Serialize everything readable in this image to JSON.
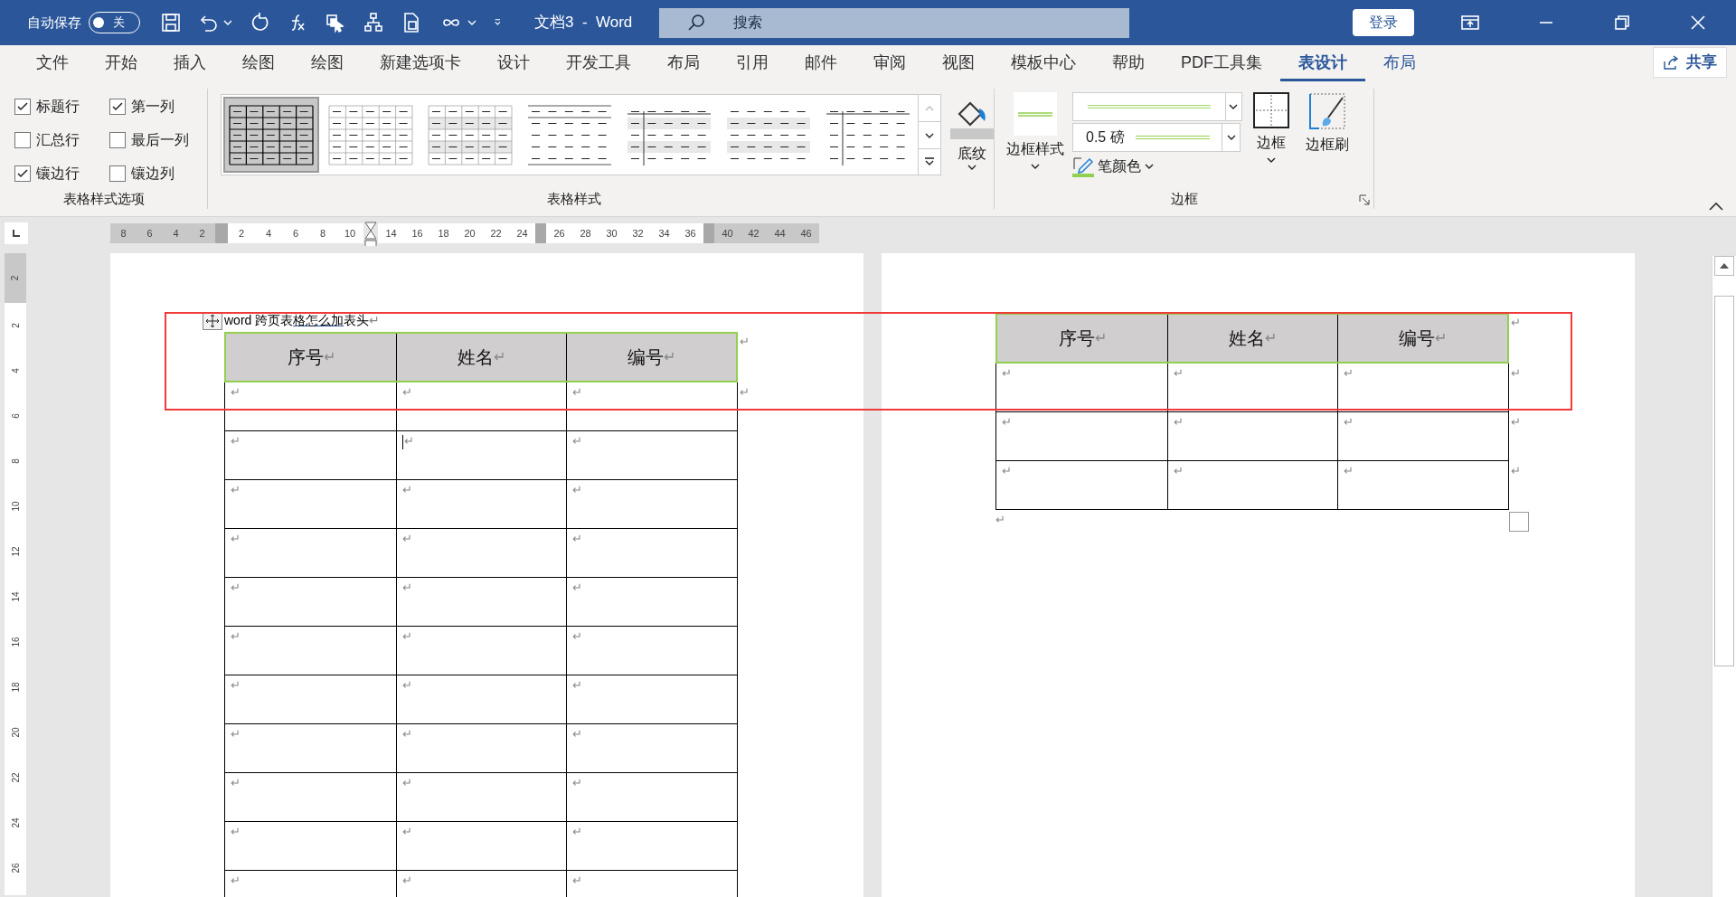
{
  "titlebar": {
    "autosave_label": "自动保存",
    "autosave_on": false,
    "autosave_state": "关",
    "title": "文档3  -  Word",
    "search": "搜索",
    "login": "登录"
  },
  "tabs": [
    {
      "label": "文件",
      "selected": false,
      "contextual": false
    },
    {
      "label": "开始",
      "selected": false,
      "contextual": false
    },
    {
      "label": "插入",
      "selected": false,
      "contextual": false
    },
    {
      "label": "绘图",
      "selected": false,
      "contextual": false
    },
    {
      "label": "绘图",
      "selected": false,
      "contextual": false
    },
    {
      "label": "新建选项卡",
      "selected": false,
      "contextual": false
    },
    {
      "label": "设计",
      "selected": false,
      "contextual": false
    },
    {
      "label": "开发工具",
      "selected": false,
      "contextual": false
    },
    {
      "label": "布局",
      "selected": false,
      "contextual": false
    },
    {
      "label": "引用",
      "selected": false,
      "contextual": false
    },
    {
      "label": "邮件",
      "selected": false,
      "contextual": false
    },
    {
      "label": "审阅",
      "selected": false,
      "contextual": false
    },
    {
      "label": "视图",
      "selected": false,
      "contextual": false
    },
    {
      "label": "模板中心",
      "selected": false,
      "contextual": false
    },
    {
      "label": "帮助",
      "selected": false,
      "contextual": false
    },
    {
      "label": "PDF工具集",
      "selected": false,
      "contextual": false
    },
    {
      "label": "表设计",
      "selected": true,
      "contextual": true
    },
    {
      "label": "布局",
      "selected": false,
      "contextual": true
    }
  ],
  "share": "共享",
  "ribbon": {
    "style_options": {
      "label": "表格样式选项",
      "options": [
        {
          "label": "标题行",
          "checked": true
        },
        {
          "label": "第一列",
          "checked": true
        },
        {
          "label": "汇总行",
          "checked": false
        },
        {
          "label": "最后一列",
          "checked": false
        },
        {
          "label": "镶边行",
          "checked": true
        },
        {
          "label": "镶边列",
          "checked": false
        }
      ]
    },
    "table_styles": {
      "label": "表格样式",
      "styles": [
        {
          "kind": "grid",
          "selected": true
        },
        {
          "kind": "light-grid",
          "selected": false
        },
        {
          "kind": "banded-grid",
          "selected": false
        },
        {
          "kind": "lines",
          "selected": false
        },
        {
          "kind": "first-col-banded",
          "selected": false
        },
        {
          "kind": "banded",
          "selected": false
        },
        {
          "kind": "first-col",
          "selected": false
        }
      ],
      "shading": "底纹"
    },
    "borders": {
      "label": "边框",
      "border_styles": "边框样式",
      "weight": "0.5 磅",
      "pen_color": "笔颜色",
      "borders": "边框",
      "painter": "边框刷"
    }
  },
  "ruler": {
    "left_gray": [
      "8",
      "6",
      "4",
      "2"
    ],
    "white_a": [
      "2",
      "4",
      "6",
      "8",
      "10"
    ],
    "white_b": [
      "14",
      "16",
      "18",
      "20",
      "22",
      "24"
    ],
    "white_c": [
      "26",
      "28",
      "30",
      "32",
      "34",
      "36"
    ],
    "right_gray": [
      "40",
      "42",
      "44",
      "46"
    ],
    "vertical": [
      "2",
      "2",
      "4",
      "6",
      "8",
      "10",
      "12",
      "14",
      "16",
      "18",
      "20",
      "22",
      "24",
      "26"
    ]
  },
  "left_page": {
    "heading": {
      "before": "word 跨页表",
      "underlined": "格怎么加",
      "after": "表头",
      "mark": "↵"
    },
    "table": {
      "header": [
        {
          "text": "序号",
          "mark": "↵"
        },
        {
          "text": "姓名",
          "mark": "↵"
        },
        {
          "text": "编号",
          "mark": "↵"
        }
      ],
      "header_end": "↵",
      "rows": [
        {
          "cells": [
            "↵",
            "↵",
            "↵"
          ],
          "end": "↵"
        },
        {
          "cells": [
            "↵",
            "↵",
            "↵"
          ],
          "cursor": true
        },
        {
          "cells": [
            "↵",
            "↵",
            "↵"
          ]
        },
        {
          "cells": [
            "↵",
            "↵",
            "↵"
          ]
        },
        {
          "cells": [
            "↵",
            "↵",
            "↵"
          ]
        },
        {
          "cells": [
            "↵",
            "↵",
            "↵"
          ]
        },
        {
          "cells": [
            "↵",
            "↵",
            "↵"
          ]
        },
        {
          "cells": [
            "↵",
            "↵",
            "↵"
          ]
        },
        {
          "cells": [
            "↵",
            "↵",
            "↵"
          ]
        },
        {
          "cells": [
            "↵",
            "↵",
            "↵"
          ]
        },
        {
          "cells": [
            "↵",
            "↵",
            "↵"
          ]
        }
      ]
    }
  },
  "right_page": {
    "table": {
      "header": [
        {
          "text": "序号",
          "mark": "↵"
        },
        {
          "text": "姓名",
          "mark": "↵"
        },
        {
          "text": "编号",
          "mark": "↵"
        }
      ],
      "header_end": "↵",
      "rows": [
        {
          "cells": [
            "↵",
            "↵",
            "↵"
          ],
          "end": "↵"
        },
        {
          "cells": [
            "↵",
            "↵",
            "↵"
          ],
          "end": "↵"
        },
        {
          "cells": [
            "↵",
            "↵",
            "↵"
          ],
          "end": "↵"
        }
      ]
    },
    "after_mark": "↵"
  }
}
